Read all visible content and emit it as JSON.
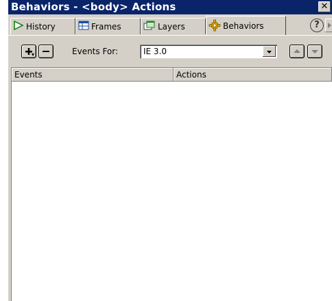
{
  "window": {
    "title": "Behaviors - <body> Actions",
    "close_glyph": "✕"
  },
  "tabs": [
    {
      "label": "History",
      "icon": "play-triangle-icon"
    },
    {
      "label": "Frames",
      "icon": "frames-grid-icon"
    },
    {
      "label": "Layers",
      "icon": "layers-icon"
    },
    {
      "label": "Behaviors",
      "icon": "gear-icon",
      "active": true
    }
  ],
  "help_glyph": "?",
  "toolbar": {
    "add_icon": "plus-icon",
    "remove_icon": "minus-icon",
    "events_for_label": "Events For:",
    "events_for_value": "IE 3.0",
    "move_up_icon": "up-arrow-icon",
    "move_down_icon": "down-arrow-icon"
  },
  "list": {
    "columns": [
      "Events",
      "Actions"
    ],
    "rows": []
  },
  "colors": {
    "titlebar": "#0a246a",
    "face": "#d4d0c8",
    "canvas": "#ffffff"
  }
}
